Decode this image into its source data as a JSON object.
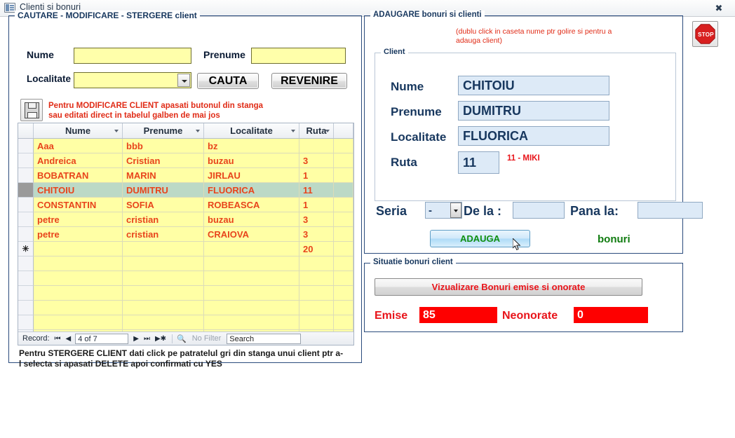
{
  "window": {
    "title": "Clienti si bonuri",
    "icon": "access-form-icon",
    "close_label": "✖"
  },
  "left_panel": {
    "legend": "CAUTARE - MODIFICARE - STERGERE client",
    "nume_label": "Nume",
    "nume_value": "",
    "prenume_label": "Prenume",
    "prenume_value": "",
    "localitate_label": "Localitate",
    "localitate_value": "",
    "cauta_button": "CAUTA",
    "revenire_button": "REVENIRE",
    "save_icon": "floppy-disk-icon",
    "modify_hint_line1": "Pentru MODIFICARE CLIENT apasati butonul din stanga",
    "modify_hint_line2": "sau editati direct in tabelul galben de mai jos",
    "delete_hint_line1": "Pentru STERGERE CLIENT dati click pe patratelul gri din stanga unui client ptr a-",
    "delete_hint_line2": "l selecta si apasati DELETE apoi confirmati cu YES"
  },
  "grid": {
    "columns": [
      "Nume",
      "Prenume",
      "Localitate",
      "Ruta"
    ],
    "rows": [
      {
        "sel": "",
        "nume": "Aaa",
        "prenume": "bbb",
        "localitate": "bz",
        "ruta": "",
        "current": false,
        "new": false
      },
      {
        "sel": "",
        "nume": "Andreica",
        "prenume": "Cristian",
        "localitate": "buzau",
        "ruta": "3",
        "current": false,
        "new": false
      },
      {
        "sel": "",
        "nume": "BOBATRAN",
        "prenume": "MARIN",
        "localitate": "JIRLAU",
        "ruta": "1",
        "current": false,
        "new": false
      },
      {
        "sel": "",
        "nume": "CHITOIU",
        "prenume": "DUMITRU",
        "localitate": "FLUORICA",
        "ruta": "11",
        "current": true,
        "new": false
      },
      {
        "sel": "",
        "nume": "CONSTANTIN",
        "prenume": "SOFIA",
        "localitate": "ROBEASCA",
        "ruta": "1",
        "current": false,
        "new": false
      },
      {
        "sel": "",
        "nume": "petre",
        "prenume": "cristian",
        "localitate": "buzau",
        "ruta": "3",
        "current": false,
        "new": false
      },
      {
        "sel": "",
        "nume": "petre",
        "prenume": "cristian",
        "localitate": "CRAIOVA",
        "ruta": "3",
        "current": false,
        "new": false
      },
      {
        "sel": "✳",
        "nume": "",
        "prenume": "",
        "localitate": "",
        "ruta": "20",
        "current": false,
        "new": true
      },
      {
        "sel": "",
        "nume": "",
        "prenume": "",
        "localitate": "",
        "ruta": "",
        "current": false,
        "new": false
      },
      {
        "sel": "",
        "nume": "",
        "prenume": "",
        "localitate": "",
        "ruta": "",
        "current": false,
        "new": false
      },
      {
        "sel": "",
        "nume": "",
        "prenume": "",
        "localitate": "",
        "ruta": "",
        "current": false,
        "new": false
      },
      {
        "sel": "",
        "nume": "",
        "prenume": "",
        "localitate": "",
        "ruta": "",
        "current": false,
        "new": false
      },
      {
        "sel": "",
        "nume": "",
        "prenume": "",
        "localitate": "",
        "ruta": "",
        "current": false,
        "new": false
      },
      {
        "sel": "",
        "nume": "",
        "prenume": "",
        "localitate": "",
        "ruta": "",
        "current": false,
        "new": false
      }
    ],
    "nav": {
      "record_label": "Record:",
      "first": "⏮",
      "prev": "◀",
      "position": "4 of 7",
      "next": "▶",
      "last": "⏭",
      "new": "▶✱",
      "filter_icon": "funnel-icon",
      "filter_label": "No Filter",
      "search_placeholder": "Search",
      "search_value": "Search"
    }
  },
  "right_panel": {
    "legend": "ADAUGARE  bonuri si clienti",
    "double_click_hint_line1": "(dublu click in caseta nume ptr golire si pentru a",
    "double_click_hint_line2": "adauga client)",
    "client_legend": "Client",
    "nume_label": "Nume",
    "nume_value": "CHITOIU",
    "prenume_label": "Prenume",
    "prenume_value": "DUMITRU",
    "localitate_label": "Localitate",
    "localitate_value": "FLUORICA",
    "ruta_label": "Ruta",
    "ruta_value": "11",
    "ruta_info": "11 - MIKI",
    "seria_label": "Seria",
    "seria_value": "-",
    "dela_label": "De la :",
    "dela_value": "",
    "pana_label": "Pana la:",
    "pana_value": "",
    "adauga_button": "ADAUGA",
    "bonuri_label": "bonuri"
  },
  "situatie_panel": {
    "legend": "Situatie bonuri client",
    "view_button": "Vizualizare Bonuri emise si onorate",
    "emise_label": "Emise",
    "emise_value": "85",
    "neonorate_label": "Neonorate",
    "neonorate_value": "0"
  },
  "stop_button": {
    "label": "STOP",
    "icon": "stop-sign-icon"
  },
  "colors": {
    "yellow_cell": "#ffffa5",
    "selected_row": "#bcd9c6",
    "grid_text": "#e8441c",
    "blue_field": "#ddeaf7",
    "dark_blue_text": "#17375e",
    "red_alert": "#fe0000",
    "green_text": "#109010"
  }
}
